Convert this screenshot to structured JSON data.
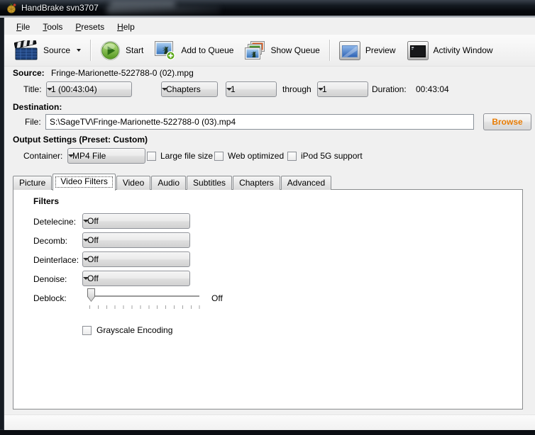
{
  "window": {
    "title": "HandBrake svn3707"
  },
  "menu": {
    "items": [
      {
        "accel": "F",
        "rest": "ile"
      },
      {
        "accel": "T",
        "rest": "ools"
      },
      {
        "accel": "P",
        "rest": "resets"
      },
      {
        "accel": "H",
        "rest": "elp"
      }
    ]
  },
  "toolbar": {
    "source": "Source",
    "start": "Start",
    "add_to_queue": "Add to Queue",
    "show_queue": "Show Queue",
    "preview": "Preview",
    "activity_window": "Activity Window"
  },
  "source": {
    "label": "Source:",
    "file": "Fringe-Marionette-522788-0 (02).mpg",
    "title_label": "Title:",
    "title_value": "1 (00:43:04)",
    "chapters_value": "Chapters",
    "range_from": "1",
    "through_label": "through",
    "range_to": "1",
    "duration_label": "Duration:",
    "duration_value": "00:43:04"
  },
  "destination": {
    "heading": "Destination:",
    "file_label": "File:",
    "file_path": "S:\\SageTV\\Fringe-Marionette-522788-0 (03).mp4",
    "browse": "Browse"
  },
  "output": {
    "heading": "Output Settings (Preset: Custom)",
    "container_label": "Container:",
    "container_value": "MP4 File",
    "checkboxes": [
      {
        "label": "Large file size",
        "checked": false
      },
      {
        "label": "Web optimized",
        "checked": false
      },
      {
        "label": "iPod 5G support",
        "checked": false
      }
    ]
  },
  "tabs": [
    {
      "label": "Picture",
      "active": false
    },
    {
      "label": "Video Filters",
      "active": true
    },
    {
      "label": "Video",
      "active": false
    },
    {
      "label": "Audio",
      "active": false
    },
    {
      "label": "Subtitles",
      "active": false
    },
    {
      "label": "Chapters",
      "active": false
    },
    {
      "label": "Advanced",
      "active": false
    }
  ],
  "filters": {
    "heading": "Filters",
    "rows": [
      {
        "label": "Detelecine:",
        "value": "Off"
      },
      {
        "label": "Decomb:",
        "value": "Off"
      },
      {
        "label": "Deinterlace:",
        "value": "Off"
      },
      {
        "label": "Denoise:",
        "value": "Off"
      }
    ],
    "deblock": {
      "label": "Deblock:",
      "value": "Off"
    },
    "grayscale": {
      "label": "Grayscale Encoding",
      "checked": false
    }
  },
  "icons": {
    "app": "handbrake-pineapple",
    "source": "film-clapperboard",
    "start": "green-play-circle",
    "add_to_queue": "photo-with-green-plus",
    "show_queue": "stacked-photos",
    "preview": "blue-window",
    "activity_window": "black-terminal-window",
    "combo_caret": "chevron-down"
  },
  "colors": {
    "accent_orange": "#e87c04",
    "start_green": "#5d9f25",
    "titlebar": "#0a0e13",
    "client_bg": "#f0f0f0"
  }
}
